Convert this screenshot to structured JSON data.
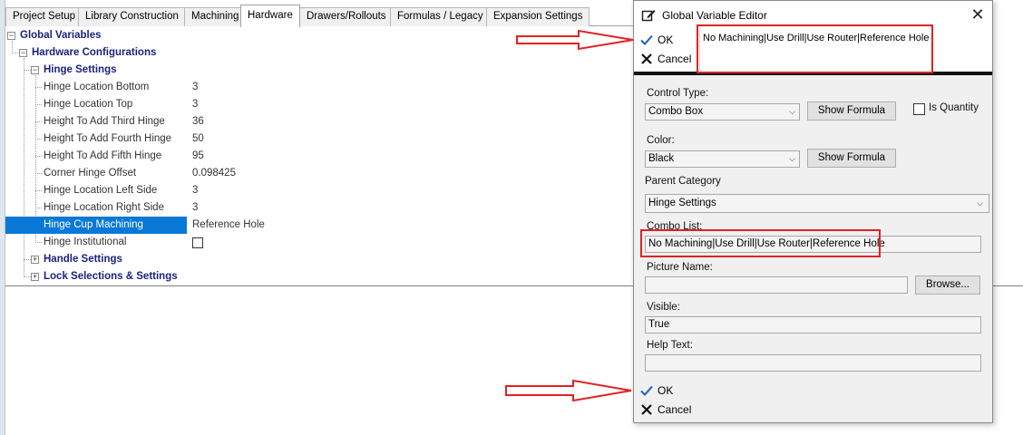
{
  "tabs": [
    "Project Setup",
    "Library Construction",
    "Machining",
    "Hardware",
    "Drawers/Rollouts",
    "Formulas / Legacy",
    "Expansion Settings"
  ],
  "tree": {
    "root": "Global Variables",
    "hardware": "Hardware Configurations",
    "hinge": "Hinge Settings",
    "handle": "Handle Settings",
    "lock": "Lock Selections & Settings",
    "properties": [
      {
        "name": "Hinge Location Bottom",
        "value": "3"
      },
      {
        "name": "Hinge Location Top",
        "value": "3"
      },
      {
        "name": "Height To Add Third Hinge",
        "value": "36"
      },
      {
        "name": "Height To Add Fourth Hinge",
        "value": "50"
      },
      {
        "name": "Height To Add Fifth Hinge",
        "value": "95"
      },
      {
        "name": "Corner Hinge Offset",
        "value": "0.098425"
      },
      {
        "name": "Hinge Location Left Side",
        "value": "3"
      },
      {
        "name": "Hinge Location Right Side",
        "value": "3"
      },
      {
        "name": "Hinge Cup Machining",
        "value": "Reference Hole"
      },
      {
        "name": "Hinge Institutional",
        "value": ""
      }
    ]
  },
  "dialog": {
    "title": "Global Variable Editor",
    "ok_label": "OK",
    "cancel_label": "Cancel",
    "top_text": "No Machining|Use Drill|Use Router|Reference Hole",
    "control_type_label": "Control Type:",
    "control_type_value": "Combo Box",
    "show_formula_label": "Show Formula",
    "is_quantity_label": "Is Quantity",
    "color_label": "Color:",
    "color_value": "Black",
    "parent_category_label": "Parent Category",
    "parent_category_value": "Hinge Settings",
    "combo_list_label": "Combo List:",
    "combo_list_value": "No Machining|Use Drill|Use Router|Reference Hole",
    "picture_name_label": "Picture Name:",
    "picture_name_value": "",
    "browse_label": "Browse...",
    "visible_label": "Visible:",
    "visible_value": "True",
    "help_text_label": "Help Text:",
    "help_text_value": ""
  },
  "icons": {
    "edit": "edit-icon",
    "close": "close-icon",
    "check": "check-icon",
    "cancel": "x-icon",
    "expand": "plus-icon",
    "collapse": "minus-icon"
  },
  "colors": {
    "selection": "#0a78d7",
    "tree_node_text": "#1a237e",
    "annotation_red": "#e02222",
    "check_blue": "#1e5fb4"
  }
}
